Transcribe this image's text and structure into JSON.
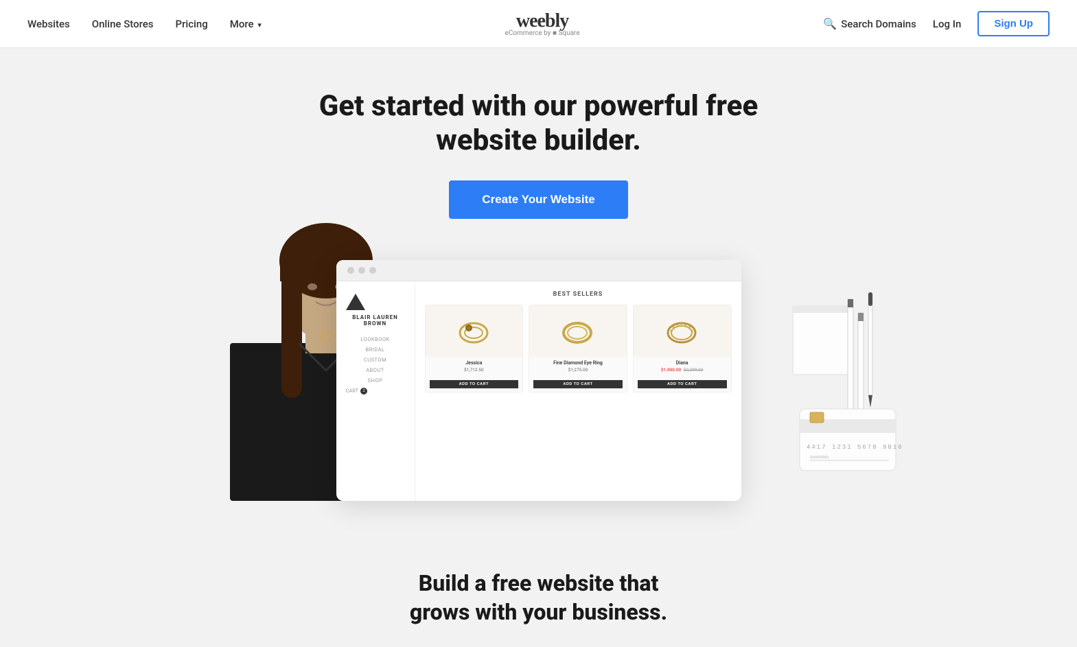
{
  "nav": {
    "links": [
      {
        "label": "Websites",
        "id": "websites"
      },
      {
        "label": "Online Stores",
        "id": "online-stores"
      },
      {
        "label": "Pricing",
        "id": "pricing"
      },
      {
        "label": "More",
        "id": "more"
      }
    ],
    "logo": {
      "text": "weebly",
      "sub": "eCommerce by ■ Square"
    },
    "search_label": "Search Domains",
    "login_label": "Log In",
    "signup_label": "Sign Up"
  },
  "hero": {
    "headline_line1": "Get started with our powerful free",
    "headline_line2": "website builder.",
    "cta_label": "Create Your Website"
  },
  "store_demo": {
    "browser_dots": [
      "dot1",
      "dot2",
      "dot3"
    ],
    "store_name": "BLAIR LAUREN BROWN",
    "nav_items": [
      "LOOKBOOK",
      "BRIDAL",
      "CUSTOM",
      "ABOUT",
      "SHOP",
      "CART"
    ],
    "cart_count": "2",
    "section_title": "BEST SELLERS",
    "products": [
      {
        "name": "Jessica",
        "price": "$1,712.50",
        "icon": "💍",
        "sale": false
      },
      {
        "name": "Fine Diamond Eye Ring",
        "price": "$1,275.00",
        "icon": "💍",
        "sale": false
      },
      {
        "name": "Diana",
        "price_sale": "$1,900.00",
        "price_original": "$2,299.00",
        "icon": "💍",
        "sale": true
      }
    ],
    "add_to_cart": "ADD TO CART"
  },
  "bottom": {
    "headline_line1": "Build a free website that",
    "headline_line2": "grows with your business."
  }
}
